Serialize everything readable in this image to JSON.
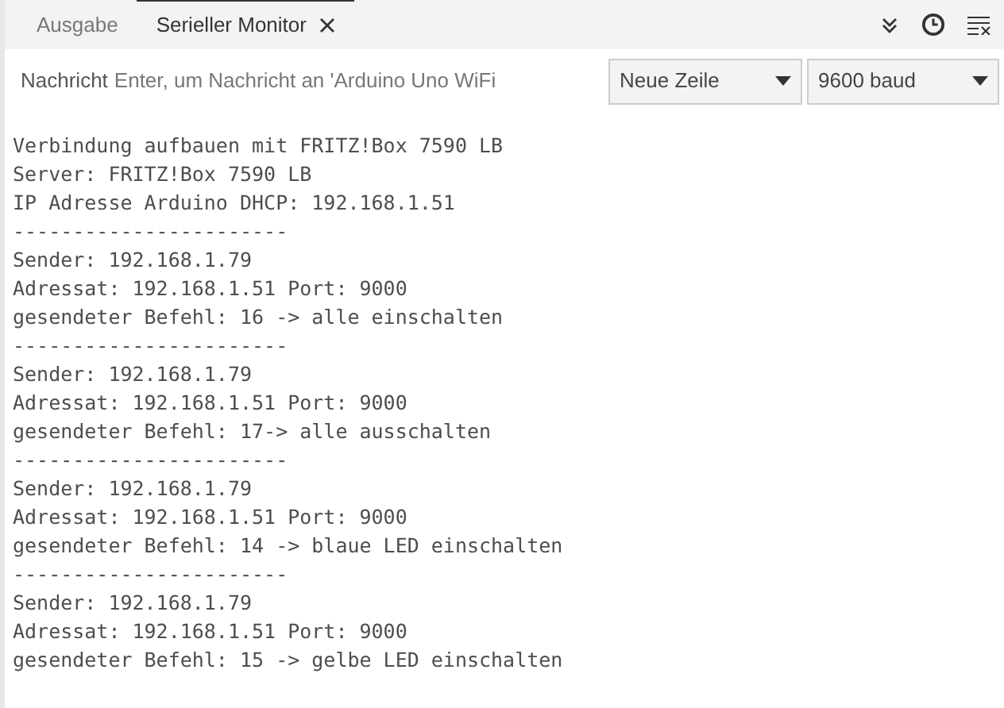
{
  "tabs": [
    {
      "label": "Ausgabe",
      "selected": false,
      "closable": false
    },
    {
      "label": "Serieller Monitor",
      "selected": true,
      "closable": true
    }
  ],
  "message": {
    "label": "Nachricht",
    "placeholder": "Enter, um Nachricht an 'Arduino Uno WiFi"
  },
  "line_ending": {
    "value": "Neue Zeile"
  },
  "baud_rate": {
    "value": "9600 baud"
  },
  "output_lines": [
    "Verbindung aufbauen mit FRITZ!Box 7590 LB",
    "Server: FRITZ!Box 7590 LB",
    "IP Adresse Arduino DHCP: 192.168.1.51",
    "-----------------------",
    "Sender: 192.168.1.79",
    "Adressat: 192.168.1.51 Port: 9000",
    "gesendeter Befehl: 16 -> alle einschalten",
    "-----------------------",
    "Sender: 192.168.1.79",
    "Adressat: 192.168.1.51 Port: 9000",
    "gesendeter Befehl: 17-> alle ausschalten",
    "-----------------------",
    "Sender: 192.168.1.79",
    "Adressat: 192.168.1.51 Port: 9000",
    "gesendeter Befehl: 14 -> blaue LED einschalten",
    "-----------------------",
    "Sender: 192.168.1.79",
    "Adressat: 192.168.1.51 Port: 9000",
    "gesendeter Befehl: 15 -> gelbe LED einschalten"
  ]
}
